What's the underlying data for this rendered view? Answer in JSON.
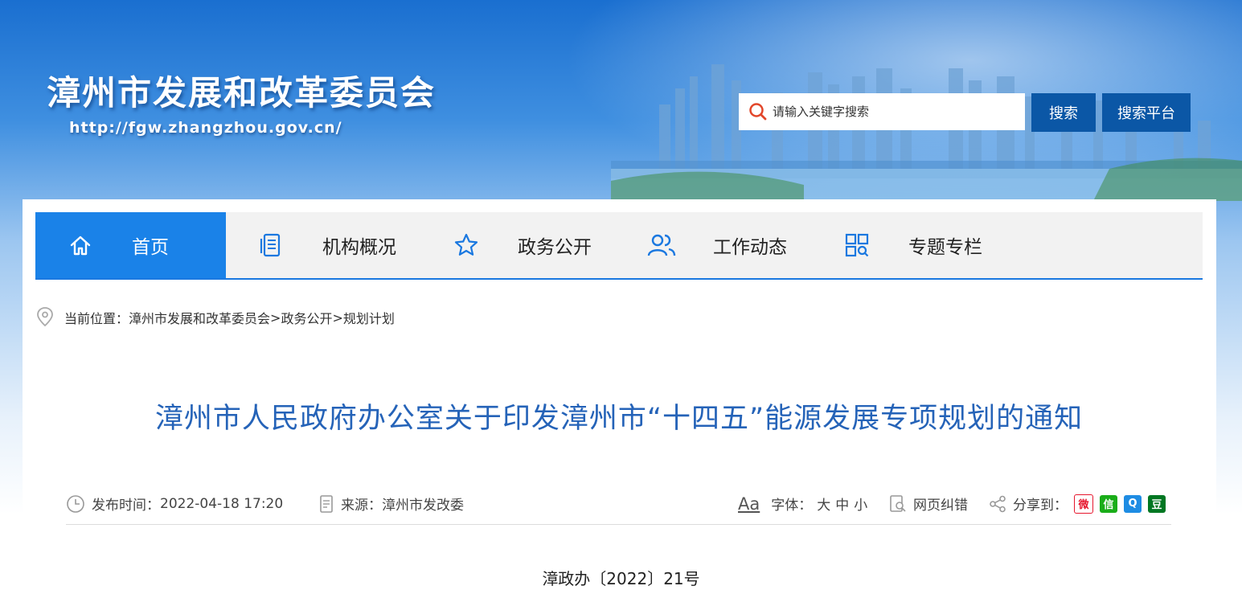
{
  "header": {
    "site_title": "漳州市发展和改革委员会",
    "site_url": "http://fgw.zhangzhou.gov.cn/",
    "search_placeholder": "请输入关键字搜索",
    "search_button": "搜索",
    "platform_button": "搜索平台"
  },
  "nav": {
    "items": [
      {
        "label": "首页",
        "icon": "home-icon",
        "active": true
      },
      {
        "label": "机构概况",
        "icon": "document-list-icon"
      },
      {
        "label": "政务公开",
        "icon": "star-icon"
      },
      {
        "label": "工作动态",
        "icon": "users-icon"
      },
      {
        "label": "专题专栏",
        "icon": "grid-search-icon"
      }
    ]
  },
  "breadcrumb": {
    "prefix": "当前位置：",
    "items": [
      "漳州市发展和改革委员会",
      "政务公开",
      "规划计划"
    ],
    "separator": ">"
  },
  "article": {
    "title": "漳州市人民政府办公室关于印发漳州市“十四五”能源发展专项规划的通知",
    "publish_label": "发布时间：",
    "publish_time": "2022-04-18 17:20",
    "source_label": "来源：",
    "source": "漳州市发改委",
    "font_icon_text": "Aa",
    "font_label": "字体：",
    "font_sizes": [
      "大",
      "中",
      "小"
    ],
    "error_label": "网页纠错",
    "share_label": "分享到：",
    "share_targets": [
      {
        "name": "weibo-icon",
        "color": "#e6162d",
        "glyph": "微"
      },
      {
        "name": "wechat-icon",
        "color": "#1aad19",
        "glyph": "信"
      },
      {
        "name": "qq-icon",
        "color": "#1e8ce3",
        "glyph": "Q"
      },
      {
        "name": "douban-icon",
        "color": "#007722",
        "glyph": "豆"
      }
    ],
    "doc_number": "漳政办〔2022〕21号"
  },
  "colors": {
    "nav_active": "#1a82e8",
    "title_blue": "#2563b8",
    "button_blue": "#0b57a6"
  }
}
